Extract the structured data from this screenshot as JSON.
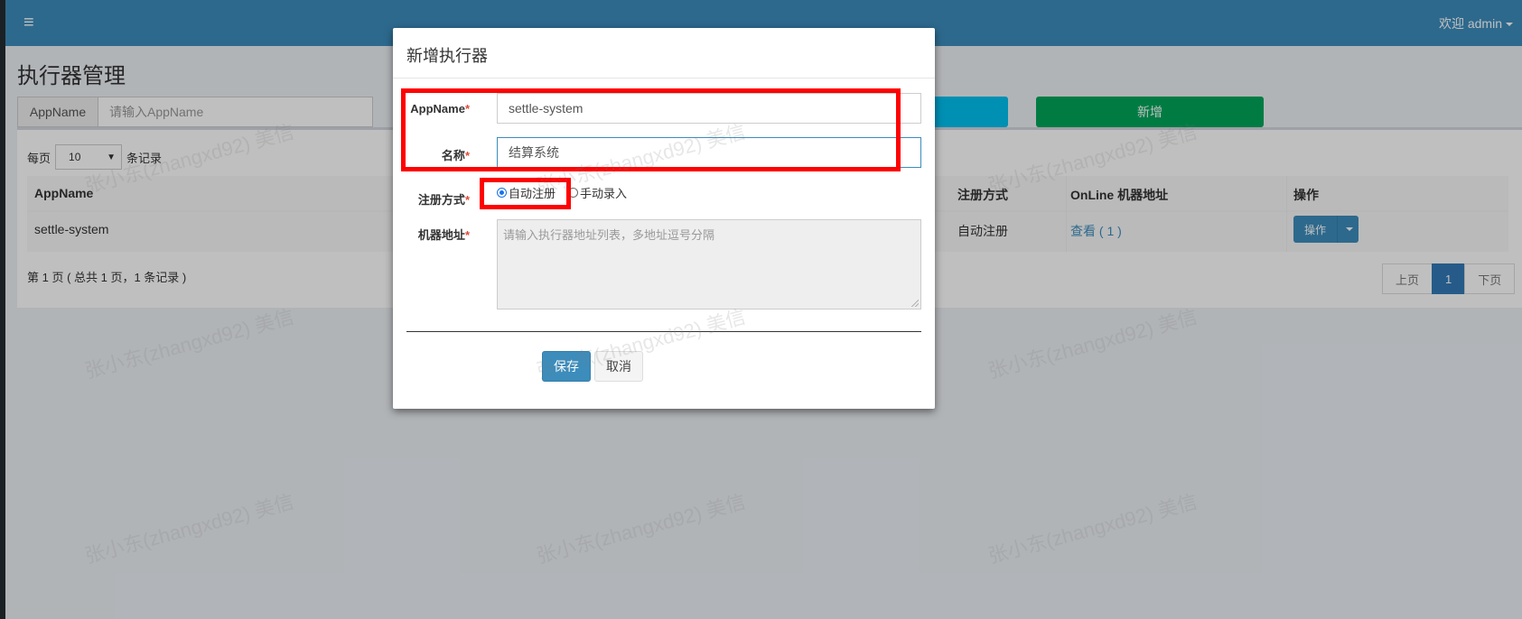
{
  "header": {
    "menu_icon": "hamburger-icon",
    "welcome": "欢迎 admin"
  },
  "page": {
    "title": "执行器管理",
    "search": {
      "addon": "AppName",
      "placeholder": "请输入AppName"
    },
    "add_button": "新增",
    "per_page_label": "每页",
    "per_page_value": "10",
    "per_page_suffix": "条记录",
    "table": {
      "headers": [
        "AppName",
        "注册方式",
        "OnLine 机器地址",
        "操作"
      ],
      "rows": [
        {
          "appname": "settle-system",
          "register": "自动注册",
          "online": "查看 ( 1 )",
          "action": "操作"
        }
      ]
    },
    "page_info": "第 1 页 ( 总共 1 页，1 条记录 )",
    "pager": {
      "prev": "上页",
      "current": "1",
      "next": "下页"
    }
  },
  "modal": {
    "title": "新增执行器",
    "fields": {
      "appname_label": "AppName",
      "appname_value": "settle-system",
      "name_label": "名称",
      "name_value": "结算系统",
      "register_label": "注册方式",
      "register_auto": "自动注册",
      "register_manual": "手动录入",
      "register_selected": "自动注册",
      "address_label": "机器地址",
      "address_placeholder": "请输入执行器地址列表，多地址逗号分隔"
    },
    "required_mark": "*",
    "save": "保存",
    "cancel": "取消"
  },
  "watermark": "张小东(zhangxd92) 美信",
  "colors": {
    "header": "#3c8dbc",
    "primary": "#3c8dbc",
    "success": "#00a65a",
    "info": "#00c0ef",
    "highlight": "#ff0000",
    "required": "#dd4b39"
  }
}
